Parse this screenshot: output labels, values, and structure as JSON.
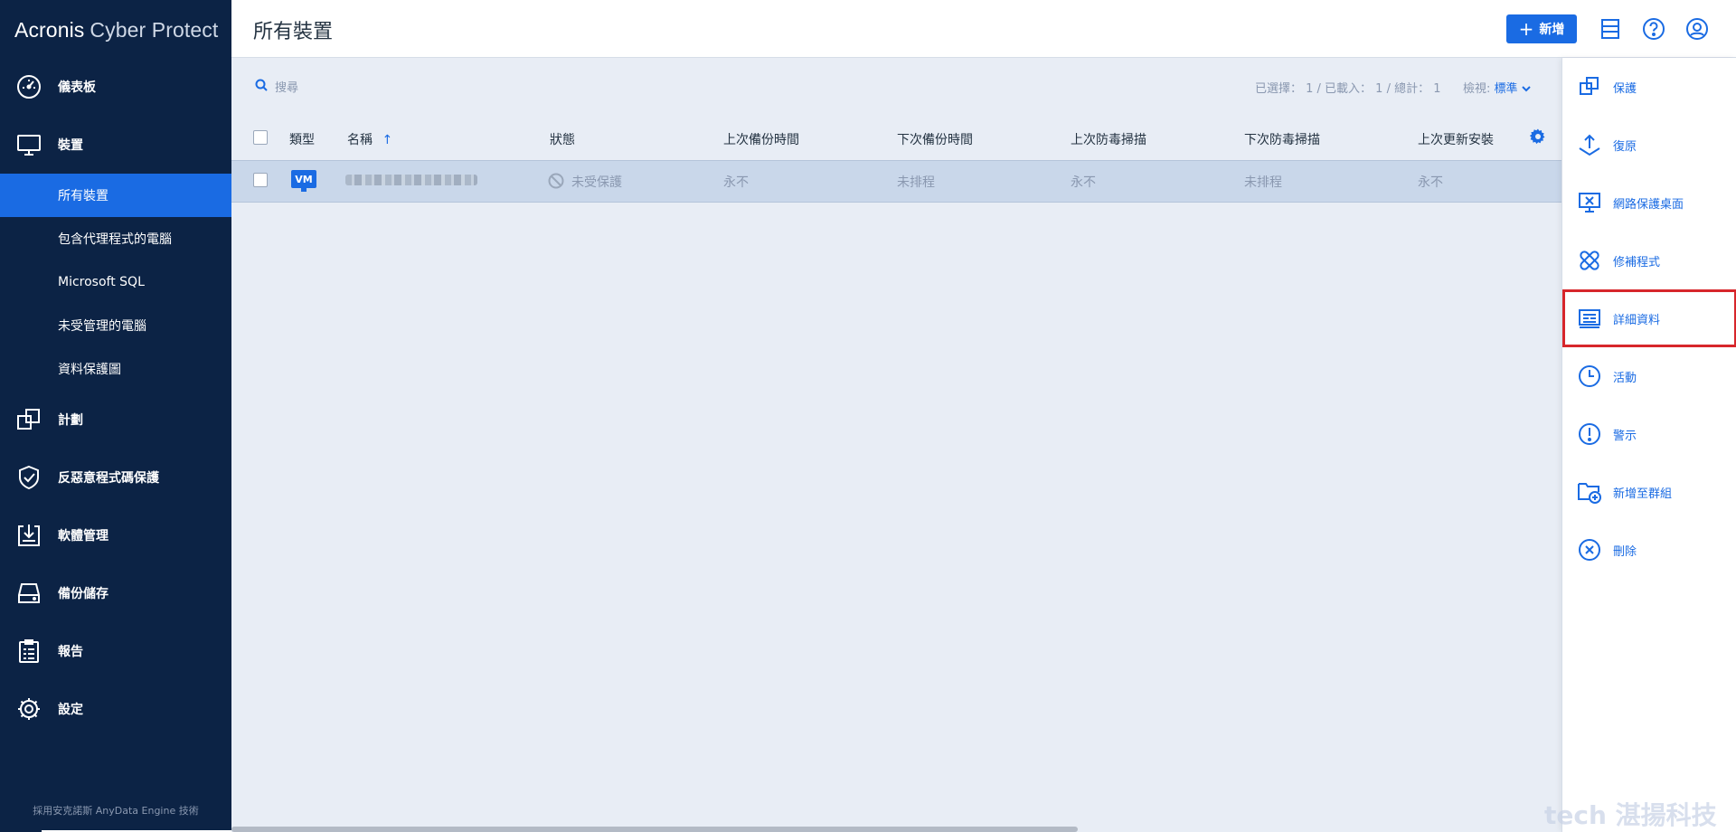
{
  "app": {
    "brand_part1": "Acronis",
    "brand_part2": "Cyber Protect",
    "footer": "採用安克諾斯 AnyData Engine 技術"
  },
  "sidebar": {
    "items": [
      {
        "label": "儀表板",
        "icon": "dashboard-icon"
      },
      {
        "label": "裝置",
        "icon": "monitor-icon"
      },
      {
        "label": "計劃",
        "icon": "plans-icon"
      },
      {
        "label": "反惡意程式碼保護",
        "icon": "shield-check-icon"
      },
      {
        "label": "軟體管理",
        "icon": "software-download-icon"
      },
      {
        "label": "備份儲存",
        "icon": "storage-drive-icon"
      },
      {
        "label": "報告",
        "icon": "clipboard-report-icon"
      },
      {
        "label": "設定",
        "icon": "gear-icon"
      }
    ],
    "subitems": [
      {
        "label": "所有裝置",
        "active": true
      },
      {
        "label": "包含代理程式的電腦"
      },
      {
        "label": "Microsoft SQL"
      },
      {
        "label": "未受管理的電腦"
      },
      {
        "label": "資料保護圖"
      }
    ]
  },
  "header": {
    "title": "所有裝置",
    "new_label": "新增"
  },
  "toolbar": {
    "search_placeholder": "搜尋",
    "stats": "已選擇： 1 / 已載入： 1 / 總計： 1",
    "view_label": "檢視:",
    "view_value": "標準"
  },
  "table": {
    "columns": [
      "類型",
      "名稱",
      "狀態",
      "上次備份時間",
      "下次備份時間",
      "上次防毒掃描",
      "下次防毒掃描",
      "上次更新安裝"
    ],
    "sort_arrow": "↑",
    "rows": [
      {
        "type": "VM",
        "status": "未受保護",
        "last_backup": "永不",
        "next_backup": "未排程",
        "last_av": "永不",
        "next_av": "未排程",
        "last_update": "永不"
      }
    ]
  },
  "actions": [
    {
      "label": "保護",
      "icon": "protect-icon"
    },
    {
      "label": "復原",
      "icon": "recover-icon"
    },
    {
      "label": "網路保護桌面",
      "icon": "desktop-protect-icon"
    },
    {
      "label": "修補程式",
      "icon": "patch-icon"
    },
    {
      "label": "詳細資料",
      "icon": "details-icon",
      "highlighted": true
    },
    {
      "label": "活動",
      "icon": "clock-icon"
    },
    {
      "label": "警示",
      "icon": "alert-icon"
    },
    {
      "label": "新增至群組",
      "icon": "add-to-group-icon"
    },
    {
      "label": "刪除",
      "icon": "delete-icon"
    }
  ],
  "colors": {
    "sidebar_bg": "#0c2345",
    "accent": "#1a6be3",
    "highlight_border": "#d7262b"
  },
  "watermark": "tech 湛揚科技"
}
